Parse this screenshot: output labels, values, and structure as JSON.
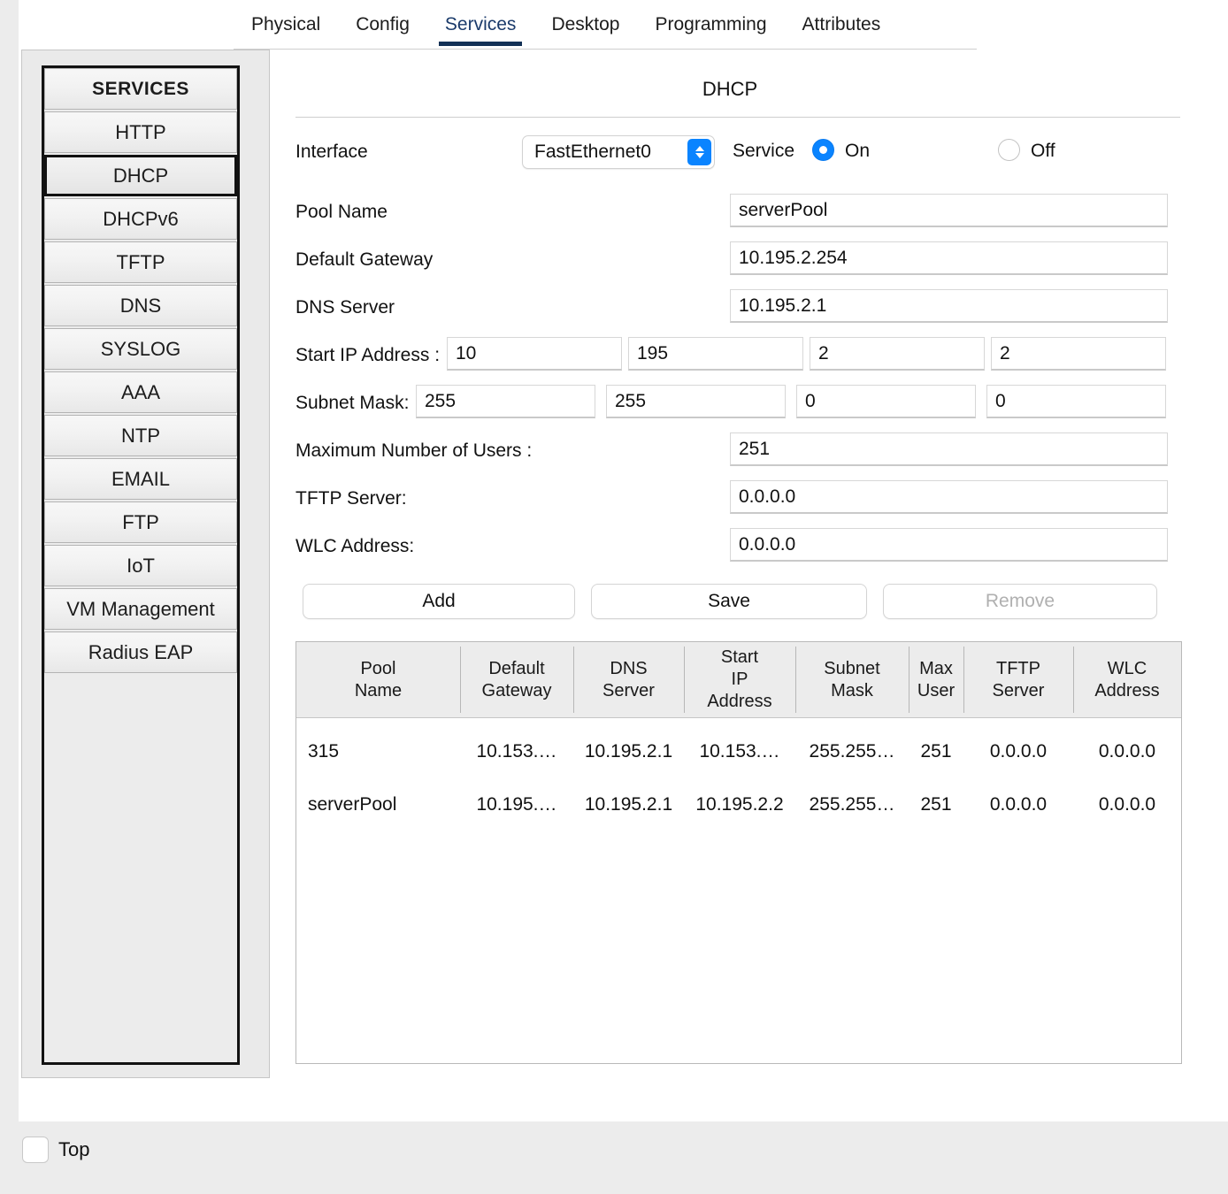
{
  "tabs": [
    {
      "label": "Physical",
      "active": false
    },
    {
      "label": "Config",
      "active": false
    },
    {
      "label": "Services",
      "active": true
    },
    {
      "label": "Desktop",
      "active": false
    },
    {
      "label": "Programming",
      "active": false
    },
    {
      "label": "Attributes",
      "active": false
    }
  ],
  "sidebar": {
    "header": "SERVICES",
    "items": [
      {
        "label": "HTTP",
        "selected": false
      },
      {
        "label": "DHCP",
        "selected": true
      },
      {
        "label": "DHCPv6",
        "selected": false
      },
      {
        "label": "TFTP",
        "selected": false
      },
      {
        "label": "DNS",
        "selected": false
      },
      {
        "label": "SYSLOG",
        "selected": false
      },
      {
        "label": "AAA",
        "selected": false
      },
      {
        "label": "NTP",
        "selected": false
      },
      {
        "label": "EMAIL",
        "selected": false
      },
      {
        "label": "FTP",
        "selected": false
      },
      {
        "label": "IoT",
        "selected": false
      },
      {
        "label": "VM Management",
        "selected": false
      },
      {
        "label": "Radius EAP",
        "selected": false
      }
    ]
  },
  "panel": {
    "title": "DHCP",
    "interface_label": "Interface",
    "interface_value": "FastEthernet0",
    "service_label": "Service",
    "service_on_label": "On",
    "service_off_label": "Off",
    "service_state": "On",
    "pool_name_label": "Pool Name",
    "pool_name_value": "serverPool",
    "default_gateway_label": "Default Gateway",
    "default_gateway_value": "10.195.2.254",
    "dns_server_label": "DNS Server",
    "dns_server_value": "10.195.2.1",
    "start_ip_label": "Start IP Address :",
    "start_ip_octets": [
      "10",
      "195",
      "2",
      "2"
    ],
    "subnet_mask_label": "Subnet Mask:",
    "subnet_mask_octets": [
      "255",
      "255",
      "0",
      "0"
    ],
    "max_users_label": "Maximum Number of Users :",
    "max_users_value": "251",
    "tftp_server_label": "TFTP Server:",
    "tftp_server_value": "0.0.0.0",
    "wlc_address_label": "WLC Address:",
    "wlc_address_value": "0.0.0.0",
    "add_label": "Add",
    "save_label": "Save",
    "remove_label": "Remove"
  },
  "table": {
    "columns": [
      "Pool\nName",
      "Default\nGateway",
      "DNS\nServer",
      "Start\nIP\nAddress",
      "Subnet\nMask",
      "Max\nUser",
      "TFTP\nServer",
      "WLC\nAddress"
    ],
    "rows": [
      {
        "pool_name": "315",
        "default_gateway": "10.153.…",
        "dns_server": "10.195.2.1",
        "start_ip": "10.153.…",
        "subnet_mask": "255.255…",
        "max_user": "251",
        "tftp_server": "0.0.0.0",
        "wlc_address": "0.0.0.0"
      },
      {
        "pool_name": "serverPool",
        "default_gateway": "10.195.…",
        "dns_server": "10.195.2.1",
        "start_ip": "10.195.2.2",
        "subnet_mask": "255.255…",
        "max_user": "251",
        "tftp_server": "0.0.0.0",
        "wlc_address": "0.0.0.0"
      }
    ]
  },
  "footer": {
    "top_checkbox_label": "Top",
    "top_checked": false
  },
  "colors": {
    "accent": "#0a84ff",
    "tab_active": "#123055",
    "panel_bg": "#ffffff",
    "window_bg": "#ececec"
  }
}
